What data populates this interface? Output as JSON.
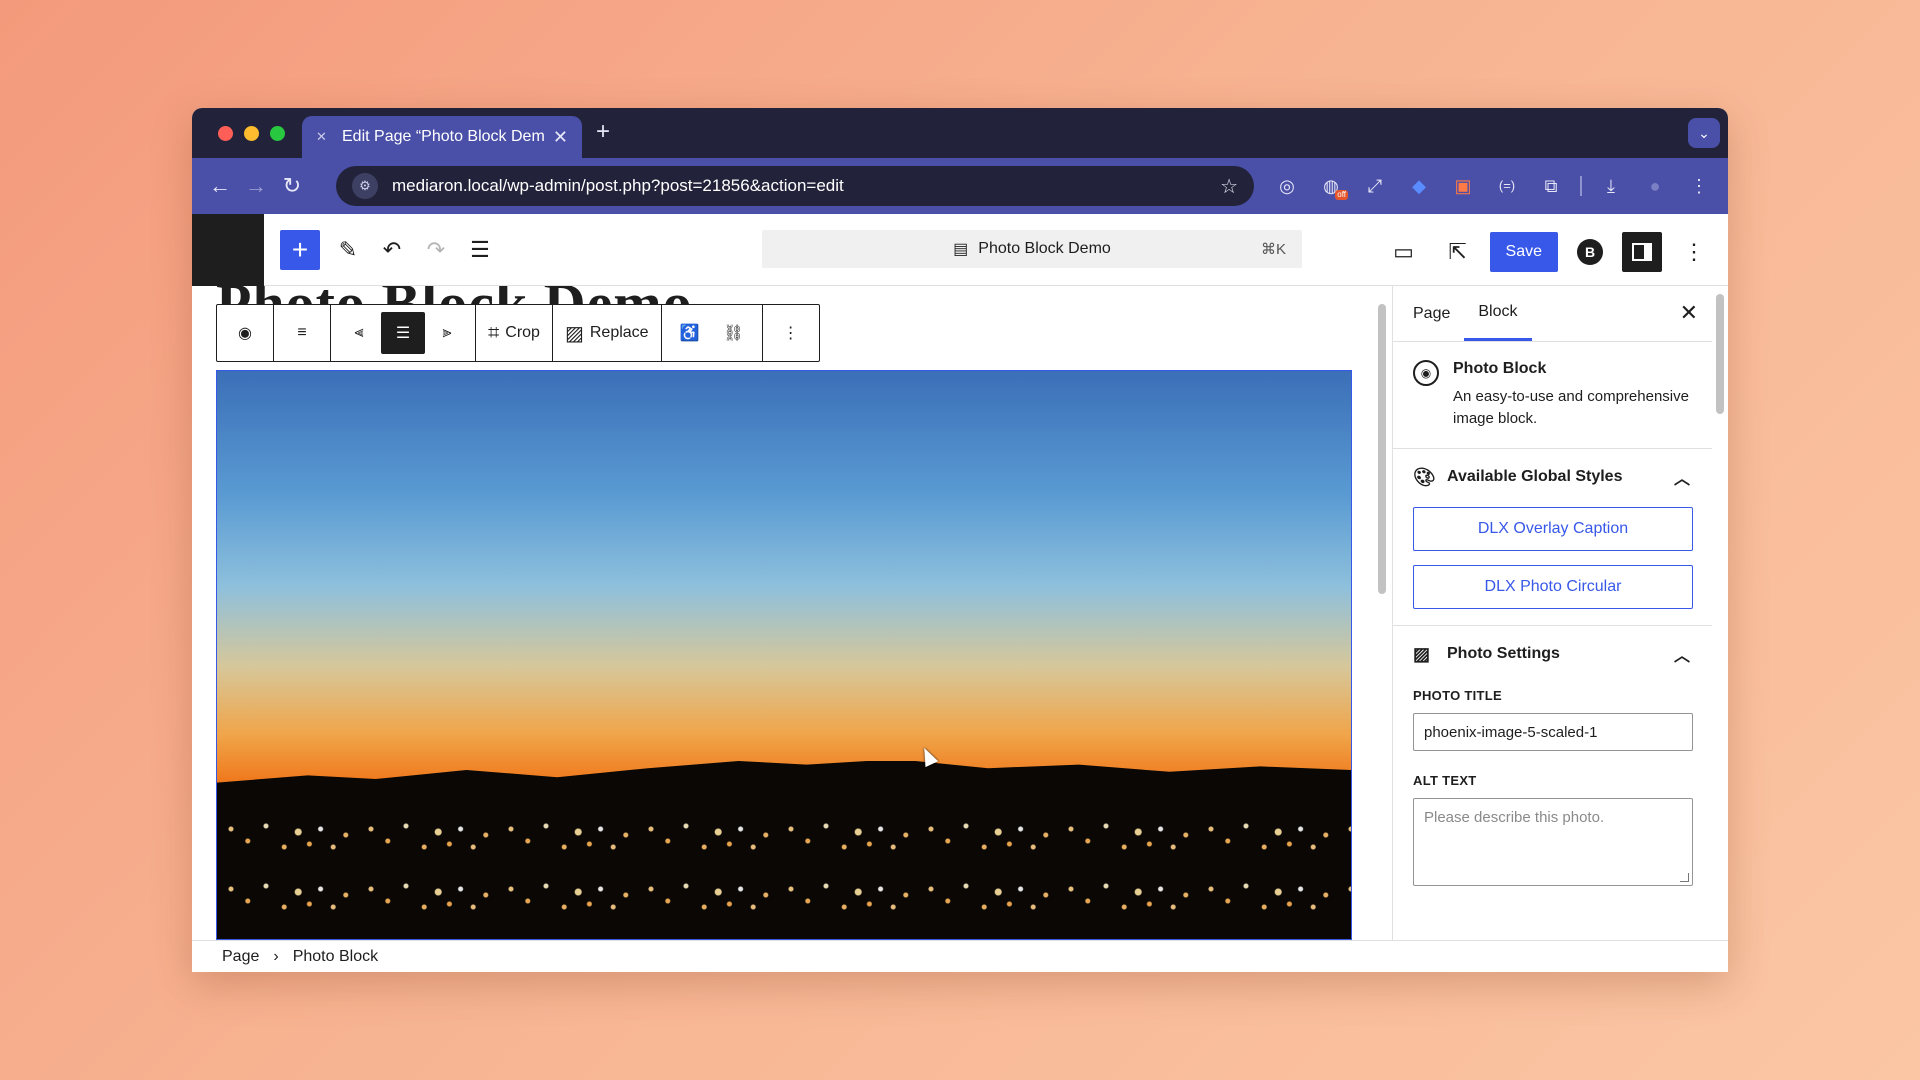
{
  "browser": {
    "tab_title": "Edit Page “Photo Block Demo",
    "url": "mediaron.local/wp-admin/post.php?post=21856&action=edit",
    "new_tab_symbol": "+",
    "extension_badge": "off"
  },
  "editor": {
    "document_title": "Photo Block Demo",
    "shortcut": "⌘K",
    "save_label": "Save",
    "page_title": "Photo Block Demo"
  },
  "block_toolbar": {
    "crop_label": "Crop",
    "replace_label": "Replace"
  },
  "breadcrumbs": {
    "root": "Page",
    "separator": "›",
    "current": "Photo Block"
  },
  "sidebar": {
    "tabs": [
      {
        "label": "Page"
      },
      {
        "label": "Block"
      }
    ],
    "block": {
      "name": "Photo Block",
      "description": "An easy-to-use and comprehensive image block."
    },
    "global_styles": {
      "title": "Available Global Styles",
      "buttons": [
        {
          "label": "DLX Overlay Caption"
        },
        {
          "label": "DLX Photo Circular"
        }
      ]
    },
    "photo_settings": {
      "title": "Photo Settings",
      "photo_title_label": "PHOTO TITLE",
      "photo_title_value": "phoenix-image-5-scaled-1",
      "alt_text_label": "ALT TEXT",
      "alt_text_placeholder": "Please describe this photo."
    }
  },
  "colors": {
    "accent": "#3858e9",
    "chrome_dark": "#22233a",
    "chrome_tab": "#4a4fa8"
  }
}
